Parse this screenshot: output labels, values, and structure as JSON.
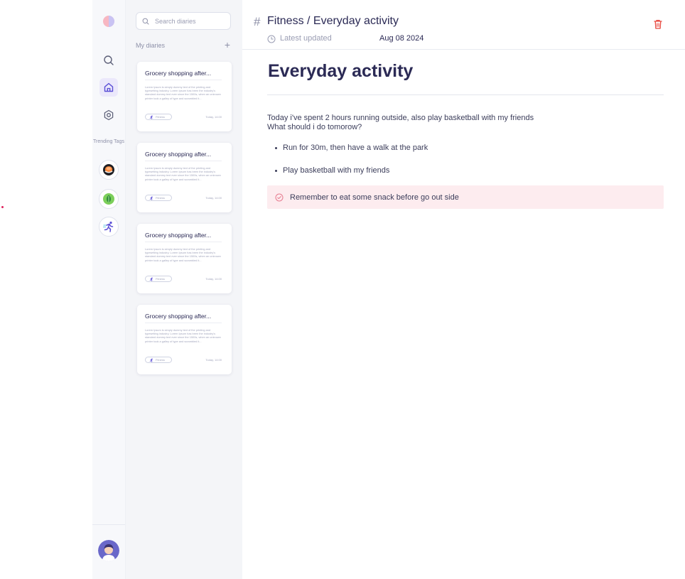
{
  "search": {
    "placeholder": "Search diaries"
  },
  "sidebar": {
    "trending_label": "Trending Tags",
    "icons": [
      "search-icon",
      "home-icon",
      "settings-icon"
    ],
    "tags": [
      "sushi-tag-icon",
      "leaf-tag-icon",
      "runner-tag-icon"
    ]
  },
  "diaries": {
    "section_title": "My diaries",
    "add_label": "+",
    "cards": [
      {
        "title": "Grocery shopping after...",
        "excerpt": "Lorem Ipsum is simply dummy text of the printing and typesetting industry. Lorem Ipsum has been the industry's standard dummy text ever since the 1500s, when an unknown printer took a galley of type and scrambled it...",
        "tag": "Fitness",
        "time": "Today, 14:00"
      },
      {
        "title": "Grocery shopping after...",
        "excerpt": "Lorem Ipsum is simply dummy text of the printing and typesetting industry. Lorem Ipsum has been the industry's standard dummy text ever since the 1500s, when an unknown printer took a galley of type and scrambled it...",
        "tag": "Fitness",
        "time": "Today, 14:00"
      },
      {
        "title": "Grocery shopping after...",
        "excerpt": "Lorem Ipsum is simply dummy text of the printing and typesetting industry. Lorem Ipsum has been the industry's standard dummy text ever since the 1500s, when an unknown printer took a galley of type and scrambled it...",
        "tag": "Fitness",
        "time": "Today, 14:00"
      },
      {
        "title": "Grocery shopping after...",
        "excerpt": "Lorem Ipsum is simply dummy text of the printing and typesetting industry. Lorem Ipsum has been the industry's standard dummy text ever since the 1500s, when an unknown printer took a galley of type and scrambled it...",
        "tag": "Fitness",
        "time": "Today, 14:00"
      }
    ]
  },
  "main": {
    "breadcrumb_hash": "#",
    "breadcrumb": "Fitness / Everyday activity",
    "updated_label": "Latest updated",
    "updated_date": "Aug 08 2024",
    "title": "Everyday activity",
    "paragraph_line1": "Today i've spent 2 hours running outside, also play basketball with my friends",
    "paragraph_line2": "What should i do tomorow?",
    "bullets": [
      "Run for 30m, then have a walk at the park",
      "Play basketball with my friends"
    ],
    "note": "Remember to eat some snack before go out side"
  },
  "colors": {
    "accent": "#5b4fd6",
    "text_dark": "#2b2a55",
    "delete": "#e8473d",
    "note_bg": "#fdecef",
    "note_icon": "#e77b8f"
  }
}
